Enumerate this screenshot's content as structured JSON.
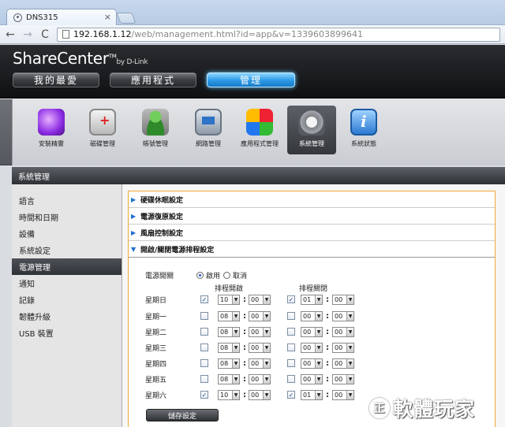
{
  "browser": {
    "tab_title": "DNS315",
    "tab_close": "×",
    "url_host": "192.168.1.12",
    "url_rest": "/web/management.html?id=app&v=1339603899641",
    "back": "←",
    "forward": "→",
    "reload": "C"
  },
  "header": {
    "brand": "ShareCenter",
    "brand_tm": "TM",
    "brand_by": "by D-Link",
    "tabs": [
      "我的最愛",
      "應用程式",
      "管理"
    ]
  },
  "apps": [
    "安裝精靈",
    "磁碟管理",
    "帳號管理",
    "網路管理",
    "應用程式管理",
    "系統管理",
    "系統狀態"
  ],
  "section_title": "系統管理",
  "sidebar": [
    "語言",
    "時間和日期",
    "設備",
    "系統設定",
    "電源管理",
    "通知",
    "記錄",
    "韌體升級",
    "USB 裝置"
  ],
  "accordion": [
    "硬碟休眠設定",
    "電源復原設定",
    "風扇控制設定",
    "開啟/關閉電源排程設定"
  ],
  "form": {
    "power_switch_label": "電源開關",
    "enable": "啟用",
    "disable": "取消",
    "on_header": "排程開啟",
    "off_header": "排程關閉",
    "days": [
      {
        "day": "星期日",
        "on_checked": true,
        "on_hour": "10",
        "on_min": "00",
        "off_checked": true,
        "off_hour": "01",
        "off_min": "00"
      },
      {
        "day": "星期一",
        "on_checked": false,
        "on_hour": "08",
        "on_min": "00",
        "off_checked": false,
        "off_hour": "00",
        "off_min": "00"
      },
      {
        "day": "星期二",
        "on_checked": false,
        "on_hour": "08",
        "on_min": "00",
        "off_checked": false,
        "off_hour": "00",
        "off_min": "00"
      },
      {
        "day": "星期三",
        "on_checked": false,
        "on_hour": "08",
        "on_min": "00",
        "off_checked": false,
        "off_hour": "00",
        "off_min": "00"
      },
      {
        "day": "星期四",
        "on_checked": false,
        "on_hour": "08",
        "on_min": "00",
        "off_checked": false,
        "off_hour": "00",
        "off_min": "00"
      },
      {
        "day": "星期五",
        "on_checked": false,
        "on_hour": "08",
        "on_min": "00",
        "off_checked": false,
        "off_hour": "00",
        "off_min": "00"
      },
      {
        "day": "星期六",
        "on_checked": true,
        "on_hour": "10",
        "on_min": "00",
        "off_checked": true,
        "off_hour": "01",
        "off_min": "00"
      }
    ],
    "colon": ":",
    "check_mark": "✓",
    "dd_arrow": "▼",
    "save": "儲存設定"
  },
  "watermark": {
    "circle": "正",
    "text": "軟體玩家"
  },
  "colors": {
    "accent": "#2f9de8",
    "panel_border": "#f0a93a"
  }
}
